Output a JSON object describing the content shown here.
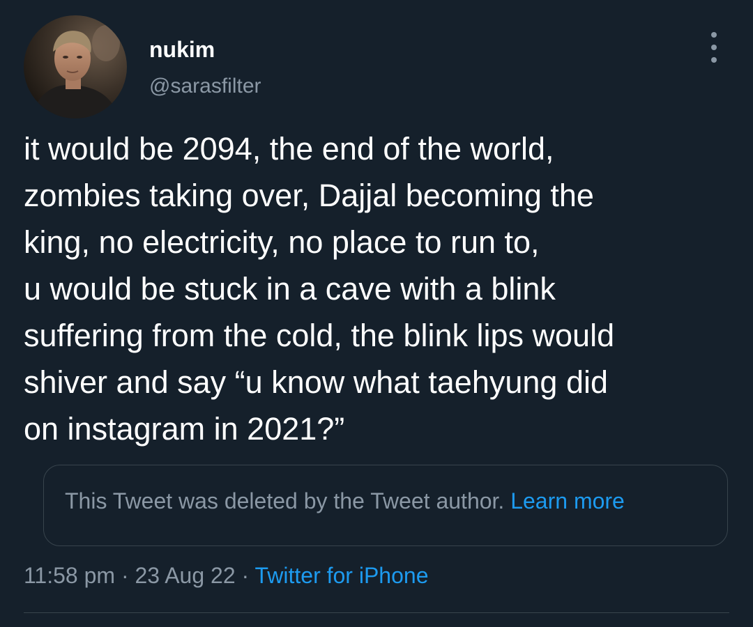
{
  "author": {
    "display_name": "nukim",
    "handle": "@sarasfilter",
    "avatar_icon": "profile-photo"
  },
  "tweet": {
    "text": "it would be 2094, the end of the world,\nzombies taking over, Dajjal becoming the\nking, no electricity, no place to run to,\nu would be stuck in a cave with a blink\nsuffering from the cold, the blink lips would\nshiver and say “u know what taehyung did\non instagram in 2021?”"
  },
  "quoted": {
    "message": "This Tweet was deleted by the Tweet author.",
    "link_label": "Learn more"
  },
  "meta": {
    "time": "11:58 pm",
    "separator": "·",
    "date": "23 Aug 22",
    "source": "Twitter for iPhone"
  },
  "icons": {
    "more": "more-vertical-icon"
  },
  "colors": {
    "background": "#15202b",
    "primary_text": "#ffffff",
    "secondary_text": "#8b98a5",
    "accent": "#1d9bf0",
    "border": "#38444d"
  }
}
